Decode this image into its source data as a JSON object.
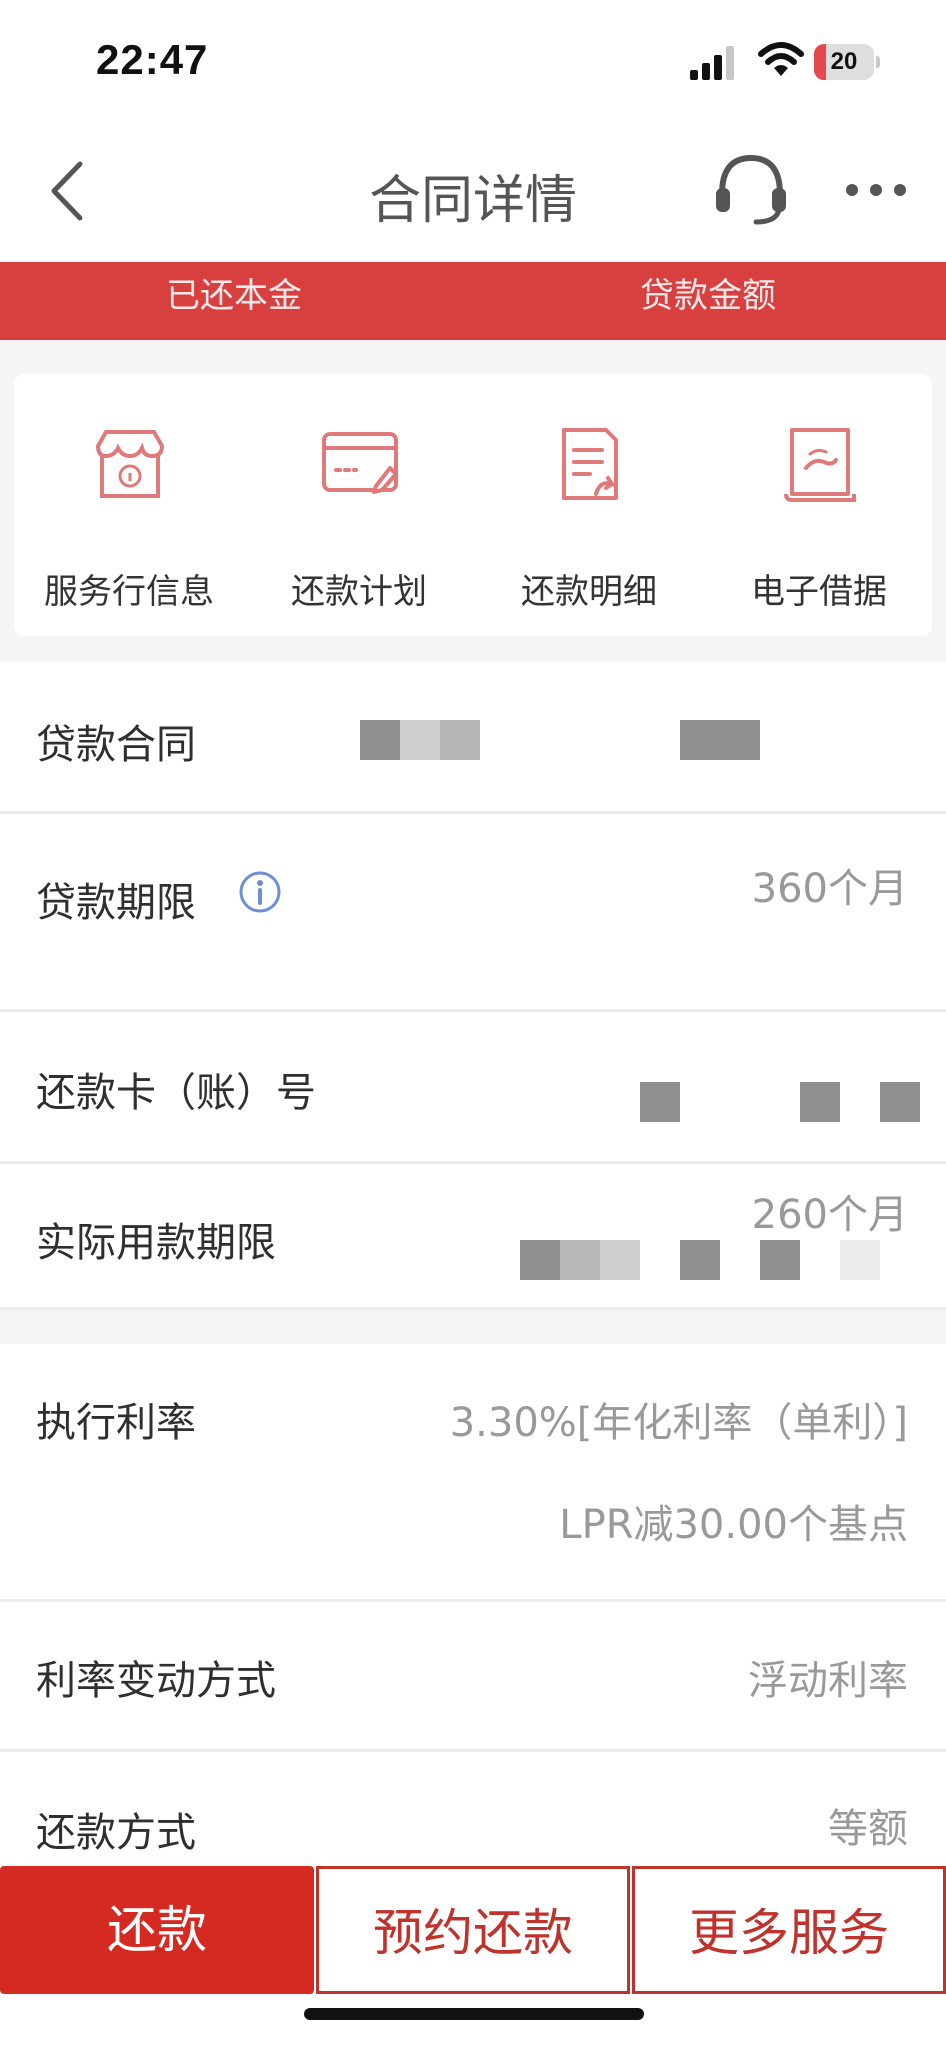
{
  "status_bar": {
    "time": "22:47",
    "battery": "20",
    "battery_level": 0.2
  },
  "nav": {
    "title": "合同详情"
  },
  "summary_band": {
    "repaid_principal_label": "已还本金",
    "loan_amount_label": "贷款金额"
  },
  "quick_services": [
    {
      "label": "服务行信息",
      "icon": "bank-info-icon"
    },
    {
      "label": "还款计划",
      "icon": "card-plan-icon"
    },
    {
      "label": "还款明细",
      "icon": "document-detail-icon"
    },
    {
      "label": "电子借据",
      "icon": "e-receipt-icon"
    }
  ],
  "details": {
    "loan_contract": {
      "label": "贷款合同"
    },
    "loan_term": {
      "label": "贷款期限",
      "value": "360个月"
    },
    "repay_card": {
      "label": "还款卡（账）号"
    },
    "actual_term": {
      "label": "实际用款期限",
      "value": "260个月"
    },
    "exec_rate": {
      "label": "执行利率",
      "value": "3.30%[年化利率（单利）]",
      "sub": "LPR减30.00个基点"
    },
    "rate_change": {
      "label": "利率变动方式",
      "value": "浮动利率"
    },
    "repay_method": {
      "label": "还款方式",
      "value": "等额"
    }
  },
  "actions": {
    "repay": "还款",
    "schedule_repay": "预约还款",
    "more_services": "更多服务"
  },
  "colors": {
    "brand_red": "#d52a22",
    "band_red": "#d7403f",
    "icon_pink": "#e07a7a",
    "info_blue": "#6d8fd6"
  }
}
